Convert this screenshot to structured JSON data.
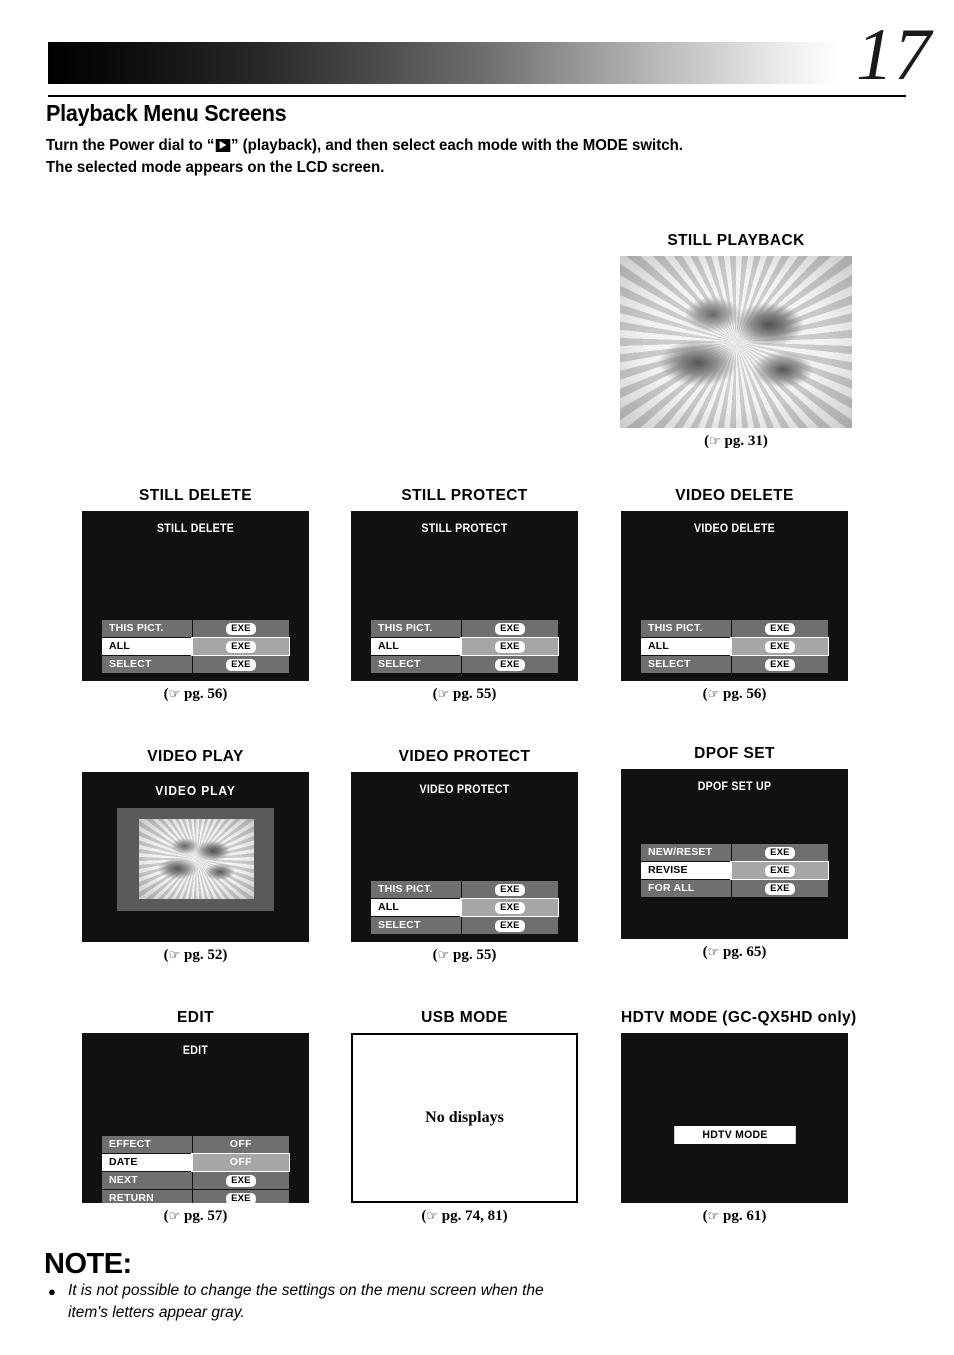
{
  "page": {
    "number": "17",
    "title": "Playback Menu Screens",
    "intro_line1_before": "Turn the Power dial to “",
    "intro_line1_after": "” (playback), and then select each mode with the MODE switch.",
    "intro_line2": "The selected mode appears on the LCD screen.",
    "playback_icon_name": "playback-icon"
  },
  "panels": [
    {
      "id": "still-playback",
      "caption": "STILL PLAYBACK",
      "screen_kind": "photo",
      "pgref": "( pg. 31)",
      "pgref_text": "pg. 31)"
    },
    {
      "id": "still-delete",
      "caption": "STILL DELETE",
      "screen_kind": "menu",
      "screen_title": "STILL DELETE",
      "pgref_text": "pg. 56)",
      "rows": [
        {
          "label": "THIS PICT.",
          "value": "EXE",
          "value_kind": "exe",
          "selected": false
        },
        {
          "label": "ALL",
          "value": "EXE",
          "value_kind": "exe",
          "selected": true
        },
        {
          "label": "SELECT",
          "value": "EXE",
          "value_kind": "exe",
          "selected": false
        }
      ]
    },
    {
      "id": "still-protect",
      "caption": "STILL PROTECT",
      "screen_kind": "menu",
      "screen_title": "STILL PROTECT",
      "pgref_text": "pg. 55)",
      "rows": [
        {
          "label": "THIS PICT.",
          "value": "EXE",
          "value_kind": "exe",
          "selected": false
        },
        {
          "label": "ALL",
          "value": "EXE",
          "value_kind": "exe",
          "selected": true
        },
        {
          "label": "SELECT",
          "value": "EXE",
          "value_kind": "exe",
          "selected": false
        }
      ]
    },
    {
      "id": "video-delete",
      "caption": "VIDEO DELETE",
      "screen_kind": "menu",
      "screen_title": "VIDEO DELETE",
      "pgref_text": "pg. 56)",
      "rows": [
        {
          "label": "THIS PICT.",
          "value": "EXE",
          "value_kind": "exe",
          "selected": false
        },
        {
          "label": "ALL",
          "value": "EXE",
          "value_kind": "exe",
          "selected": true
        },
        {
          "label": "SELECT",
          "value": "EXE",
          "value_kind": "exe",
          "selected": false
        }
      ]
    },
    {
      "id": "video-play",
      "caption": "VIDEO PLAY",
      "screen_kind": "video-play",
      "screen_title": "VIDEO PLAY",
      "pgref_text": "pg. 52)"
    },
    {
      "id": "video-protect",
      "caption": "VIDEO PROTECT",
      "screen_kind": "menu",
      "screen_title": "VIDEO PROTECT",
      "pgref_text": "pg. 55)",
      "rows": [
        {
          "label": "THIS PICT.",
          "value": "EXE",
          "value_kind": "exe",
          "selected": false
        },
        {
          "label": "ALL",
          "value": "EXE",
          "value_kind": "exe",
          "selected": true
        },
        {
          "label": "SELECT",
          "value": "EXE",
          "value_kind": "exe",
          "selected": false
        }
      ]
    },
    {
      "id": "dpof-set",
      "caption": "DPOF SET",
      "screen_kind": "menu",
      "screen_title": "DPOF SET UP",
      "pgref_text": "pg. 65)",
      "rows": [
        {
          "label": "NEW/RESET",
          "value": "EXE",
          "value_kind": "exe",
          "selected": false
        },
        {
          "label": "REVISE",
          "value": "EXE",
          "value_kind": "exe",
          "selected": true
        },
        {
          "label": "FOR ALL",
          "value": "EXE",
          "value_kind": "exe",
          "selected": false
        }
      ]
    },
    {
      "id": "edit",
      "caption": "EDIT",
      "screen_kind": "menu",
      "screen_title": "EDIT",
      "pgref_text": "pg. 57)",
      "rows": [
        {
          "label": "EFFECT",
          "value": "OFF",
          "value_kind": "text",
          "selected": false
        },
        {
          "label": "DATE",
          "value": "OFF",
          "value_kind": "text",
          "selected": true
        },
        {
          "label": "NEXT",
          "value": "EXE",
          "value_kind": "exe",
          "selected": false
        },
        {
          "label": "RETURN",
          "value": "EXE",
          "value_kind": "exe",
          "selected": false
        }
      ]
    },
    {
      "id": "usb-mode",
      "caption": "USB MODE",
      "screen_kind": "blank",
      "blank_text": "No displays",
      "pgref_text": "pg. 74, 81)"
    },
    {
      "id": "hdtv-mode",
      "caption": "HDTV MODE (GC-QX5HD only)",
      "screen_kind": "hdtv",
      "hdtv_label": "HDTV MODE",
      "pgref_text": "pg. 61)"
    }
  ],
  "note": {
    "heading": "NOTE:",
    "bullet": "●",
    "text": "It is not possible to change the settings on the menu screen when the item's letters appear gray."
  },
  "pgref_open": "(",
  "hand_glyph": "☞"
}
